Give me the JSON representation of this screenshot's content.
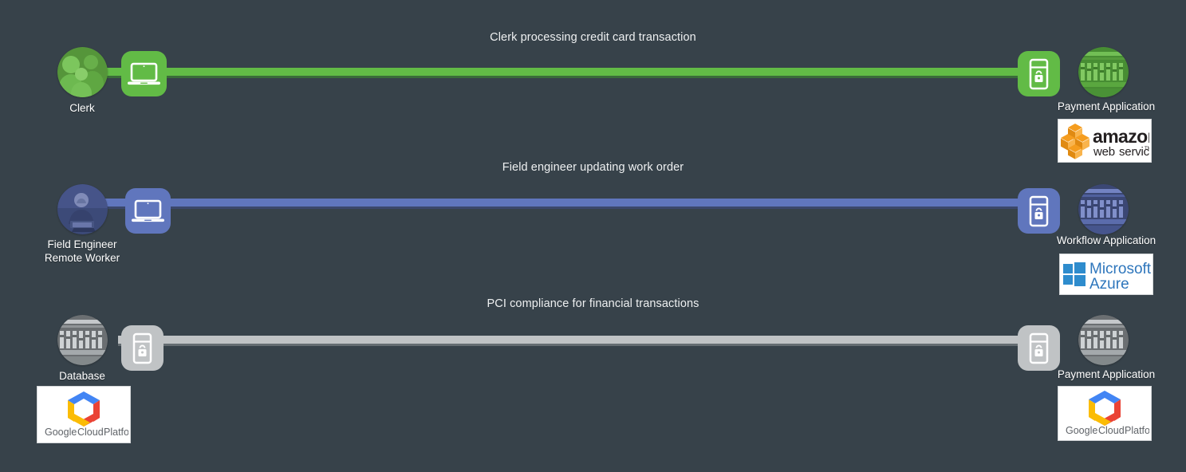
{
  "diagram": {
    "background_color": "#37424a",
    "title_color": "#eef0f1",
    "label_color": "#ffffff"
  },
  "rows": [
    {
      "id": "row-clerk",
      "title": "Clerk processing credit card transaction",
      "color": "#62bb46",
      "color_shadow": "#3e8f2b",
      "source": {
        "label": "Clerk",
        "circle_icon": "people-photo-icon",
        "device_icon": "laptop-icon"
      },
      "target": {
        "label": "Payment Application",
        "device_icon": "secure-server-icon",
        "circle_icon": "server-rack-photo-icon",
        "cloud_logo": "amazon-web-services-logo",
        "cloud_logo_text": "amazon web services"
      }
    },
    {
      "id": "row-field-engineer",
      "title": "Field engineer updating work order",
      "color": "#6076bd",
      "color_shadow": "#3f4f86",
      "source": {
        "label": "Field Engineer\nRemote Worker",
        "circle_icon": "person-laptop-photo-icon",
        "device_icon": "laptop-icon"
      },
      "target": {
        "label": "Workflow Application",
        "device_icon": "secure-server-icon",
        "circle_icon": "server-rack-photo-icon",
        "cloud_logo": "microsoft-azure-logo",
        "cloud_logo_text": "Microsoft Azure"
      }
    },
    {
      "id": "row-pci",
      "title": "PCI compliance for financial transactions",
      "color": "#c0c3c5",
      "color_shadow": "#8d9193",
      "source": {
        "label": "Database",
        "circle_icon": "server-rack-photo-icon",
        "device_icon": "secure-server-icon"
      },
      "target": {
        "label": "Payment Application",
        "device_icon": "secure-server-icon",
        "circle_icon": "server-rack-photo-icon",
        "cloud_logo": "google-cloud-platform-logo",
        "cloud_logo_text": "Google Cloud Platform"
      }
    }
  ],
  "logos": {
    "aws": {
      "line1": "amazon",
      "line2": "web services",
      "tm": "TM"
    },
    "azure": {
      "line1": "Microsoft",
      "line2": "Azure"
    },
    "gcp": {
      "word1": "Google",
      "word2": "Cloud",
      "word3": "Platform"
    }
  }
}
